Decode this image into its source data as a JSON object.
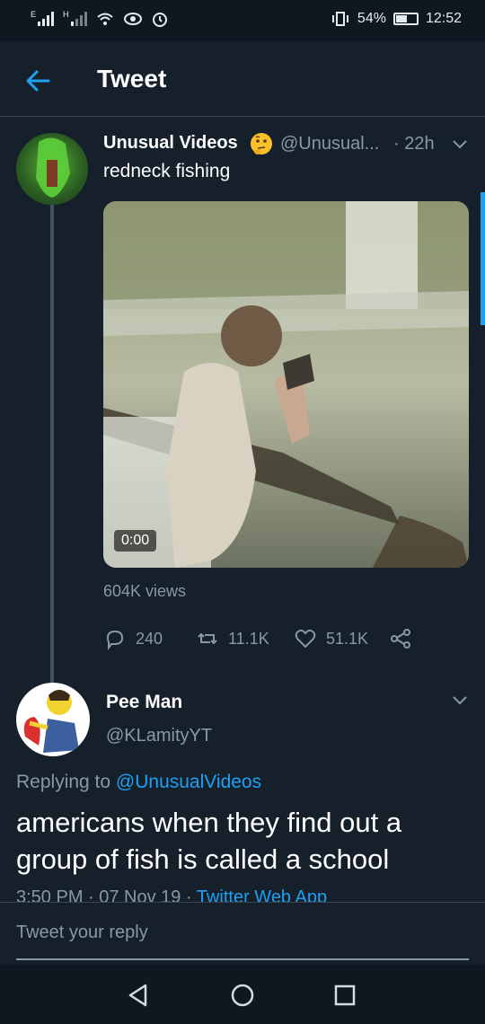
{
  "status_bar": {
    "network_label_1": "E",
    "network_label_2": "H",
    "battery_percent": "54%",
    "battery_level": 0.54,
    "time": "12:52",
    "icons": [
      "signal-icon",
      "signal-icon",
      "wifi-icon",
      "eye-icon",
      "alarm-icon",
      "vibrate-icon",
      "battery-icon"
    ]
  },
  "header": {
    "title": "Tweet",
    "back_icon": "arrow-left-icon"
  },
  "tweet": {
    "name": "Unusual Videos",
    "emoji": "thinking-face-emoji",
    "handle": "@Unusual...",
    "time": "· 22h",
    "text": "redneck fishing",
    "video_duration": "0:00",
    "views": "604K views",
    "replies": "240",
    "retweets": "11.1K",
    "likes": "51.1K"
  },
  "reply": {
    "name": "Pee Man",
    "handle": "@KLamityYT",
    "replying_prefix": "Replying to ",
    "replying_to": "@UnusualVideos",
    "text": "americans when they find out a group of fish is called a school",
    "timestamp": "3:50 PM · 07 Nov 19 · ",
    "source": "Twitter Web App"
  },
  "compose": {
    "placeholder": "Tweet your reply"
  },
  "colors": {
    "background": "#15202b",
    "accent": "#1da1f2",
    "secondary_text": "#8899a6",
    "divider": "#38444d"
  }
}
